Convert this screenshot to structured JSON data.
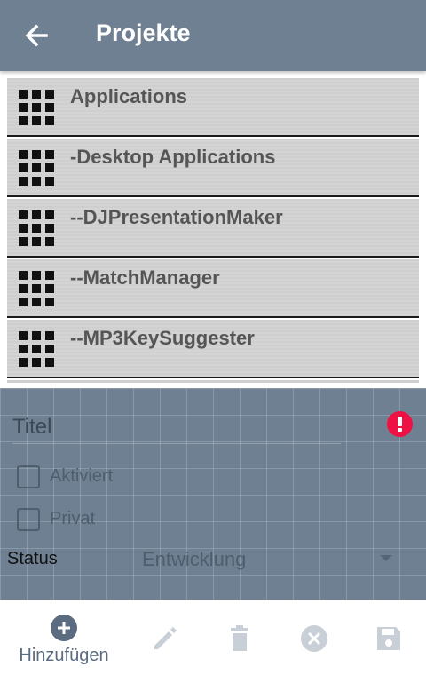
{
  "app_bar": {
    "title": "Projekte",
    "back_icon": "arrow-left-icon",
    "background": "#6f8092"
  },
  "project_list": {
    "item_icon": "grid-apps-icon",
    "items": [
      {
        "label": "Applications"
      },
      {
        "label": "-Desktop Applications"
      },
      {
        "label": "--DJPresentationMaker"
      },
      {
        "label": "--MatchManager"
      },
      {
        "label": "--MP3KeySuggester"
      }
    ]
  },
  "form": {
    "title_placeholder": "Titel",
    "title_value": "",
    "error_icon": "exclamation-circle-icon",
    "error_color": "#ee1144",
    "checkboxes": [
      {
        "label": "Aktiviert",
        "checked": false
      },
      {
        "label": "Privat",
        "checked": false
      }
    ],
    "status_label": "Status",
    "status_value": "Entwicklung"
  },
  "bottom_bar": {
    "add": {
      "label": "Hinzufügen",
      "icon": "plus-circle-icon",
      "color": "#5b6b80"
    },
    "edit": {
      "icon": "pencil-icon",
      "enabled": false
    },
    "delete": {
      "icon": "trash-icon",
      "enabled": false
    },
    "cancel": {
      "icon": "x-circle-icon",
      "enabled": false
    },
    "save": {
      "icon": "floppy-disk-icon",
      "enabled": false
    },
    "disabled_color": "#c9cfd6"
  }
}
